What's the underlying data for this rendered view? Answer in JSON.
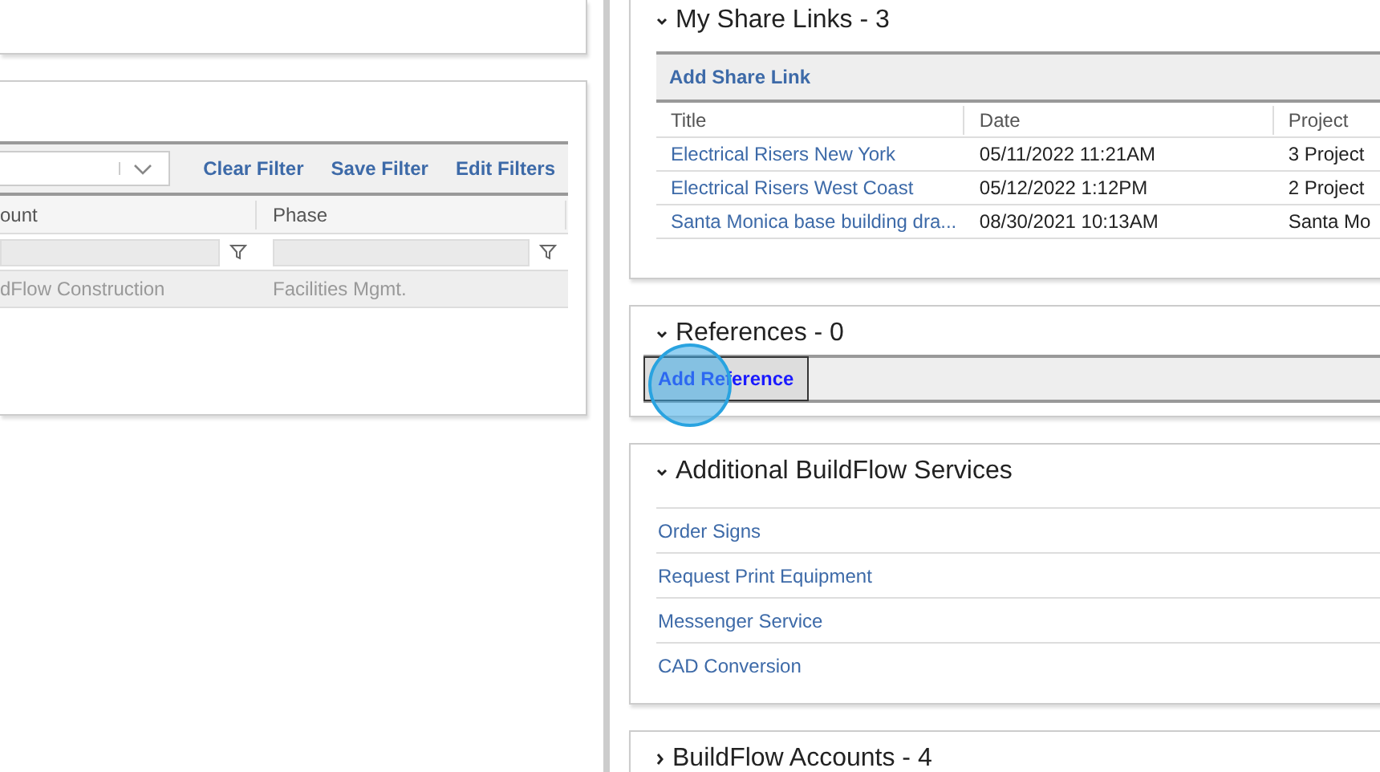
{
  "left_panel": {
    "filter_toolbar": {
      "links": [
        "Clear Filter",
        "Save Filter",
        "Edit Filters"
      ]
    },
    "table": {
      "columns": [
        "ount",
        "Phase"
      ],
      "rows": [
        [
          "dFlow Construction",
          "Facilities Mgmt."
        ]
      ]
    }
  },
  "sections": [
    {
      "kind": "table",
      "title": "My Share Links - 3",
      "expanded": true,
      "action": "Add Share Link",
      "columns": [
        "Title",
        "Date",
        "Project"
      ],
      "rows": [
        [
          "Electrical Risers New York",
          "05/11/2022 11:21AM",
          "3 Project"
        ],
        [
          "Electrical Risers West Coast",
          "05/12/2022 1:12PM",
          "2 Project"
        ],
        [
          "Santa Monica base building dra...",
          "08/30/2021 10:13AM",
          "Santa Mo"
        ]
      ]
    },
    {
      "kind": "action",
      "title": "References - 0",
      "expanded": true,
      "action": "Add Reference"
    },
    {
      "kind": "links",
      "title": "Additional BuildFlow Services",
      "expanded": true,
      "links": [
        "Order Signs",
        "Request Print Equipment",
        "Messenger Service",
        "CAD Conversion"
      ]
    },
    {
      "kind": "links",
      "title": "BuildFlow Accounts - 4",
      "expanded": false
    }
  ]
}
